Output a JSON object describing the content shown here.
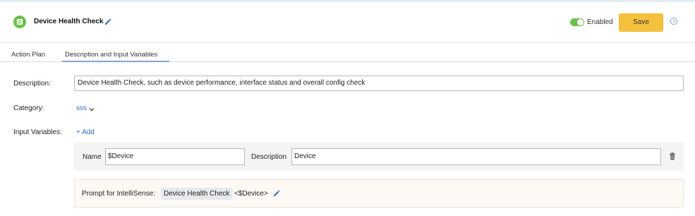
{
  "header": {
    "title": "Device Health Check",
    "enabled_label": "Enabled",
    "enabled": true,
    "save_label": "Save"
  },
  "tabs": [
    {
      "label": "Action Plan",
      "active": false
    },
    {
      "label": "Description and Input Variables",
      "active": true
    }
  ],
  "form": {
    "description_label": "Description:",
    "description_value": "Device Health Check, such as device performance, interface status and overall config check",
    "category_label": "Category:",
    "category_value": "sss",
    "input_variables_label": "Input Variables:",
    "add_label": "+ Add",
    "variables": [
      {
        "name_label": "Name",
        "name_value": "$Device",
        "description_label": "Description",
        "description_value": "Device"
      }
    ],
    "prompt": {
      "label": "Prompt for IntelliSense:",
      "chip": "Device Health Check",
      "variable": "<$Device>"
    }
  },
  "colors": {
    "accent_green": "#6cc04a",
    "save_yellow": "#f6c23e",
    "link_blue": "#2f6db5"
  },
  "icons": [
    "app-logo-icon",
    "pencil-icon",
    "history-clock-icon",
    "chevron-down-icon",
    "trash-icon"
  ]
}
